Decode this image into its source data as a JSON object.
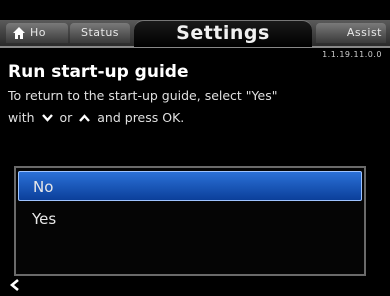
{
  "tabs": {
    "home": "Ho",
    "status": "Status",
    "settings": "Settings",
    "assist": "Assist"
  },
  "version": "1.1.19.11.0.0",
  "title": "Run start-up guide",
  "description": {
    "line1": "To return to the start-up guide, select \"Yes\"",
    "with": "with",
    "or": "or",
    "end": "and press OK."
  },
  "options": [
    {
      "label": "No",
      "selected": true
    },
    {
      "label": "Yes",
      "selected": false
    }
  ],
  "icons": {
    "home": "home-icon",
    "down": "chevron-down-icon",
    "up": "chevron-up-icon",
    "back": "back-arrow-icon"
  },
  "colors": {
    "selection": "#1f5fc4",
    "background": "#000000"
  }
}
